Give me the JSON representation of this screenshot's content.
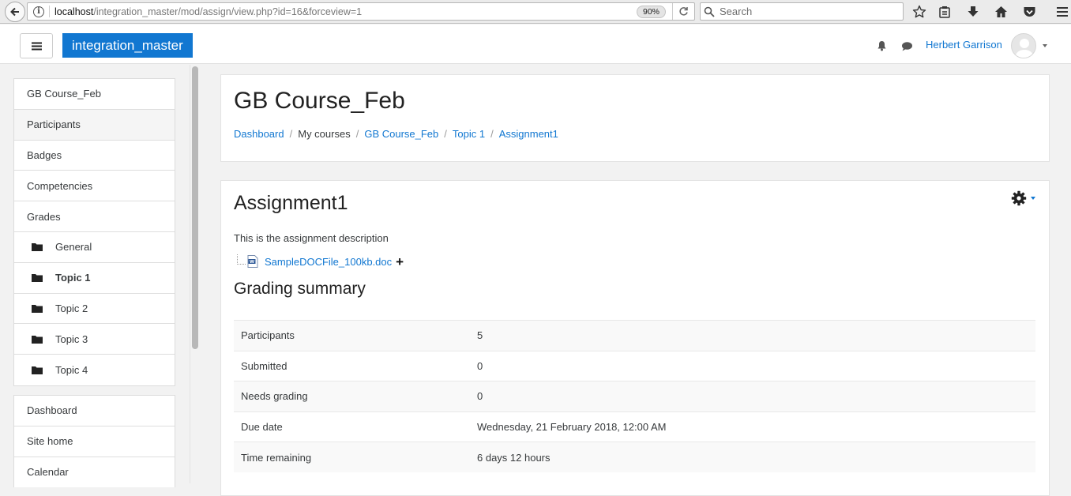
{
  "browser": {
    "url_host": "localhost",
    "url_path": "/integration_master/mod/assign/view.php?id=16&forceview=1",
    "zoom": "90%",
    "search_placeholder": "Search"
  },
  "navbar": {
    "brand": "integration_master",
    "user_name": "Herbert Garrison"
  },
  "drawer": {
    "course_items": [
      {
        "label": "GB Course_Feb"
      },
      {
        "label": "Participants"
      },
      {
        "label": "Badges"
      },
      {
        "label": "Competencies"
      },
      {
        "label": "Grades"
      },
      {
        "label": "General"
      },
      {
        "label": "Topic 1"
      },
      {
        "label": "Topic 2"
      },
      {
        "label": "Topic 3"
      },
      {
        "label": "Topic 4"
      }
    ],
    "site_items": [
      {
        "label": "Dashboard"
      },
      {
        "label": "Site home"
      },
      {
        "label": "Calendar"
      }
    ]
  },
  "header": {
    "course_title": "GB Course_Feb",
    "breadcrumb": [
      "Dashboard",
      "My courses",
      "GB Course_Feb",
      "Topic 1",
      "Assignment1"
    ]
  },
  "assignment": {
    "title": "Assignment1",
    "description": "This is the assignment description",
    "file_name": "SampleDOCFile_100kb.doc",
    "grading_title": "Grading summary",
    "summary": [
      {
        "label": "Participants",
        "value": "5"
      },
      {
        "label": "Submitted",
        "value": "0"
      },
      {
        "label": "Needs grading",
        "value": "0"
      },
      {
        "label": "Due date",
        "value": "Wednesday, 21 February 2018, 12:00 AM"
      },
      {
        "label": "Time remaining",
        "value": "6 days 12 hours"
      }
    ]
  },
  "colors": {
    "brand": "#1177d1",
    "link": "#1177d1",
    "page_bg": "#f2f2f2"
  }
}
